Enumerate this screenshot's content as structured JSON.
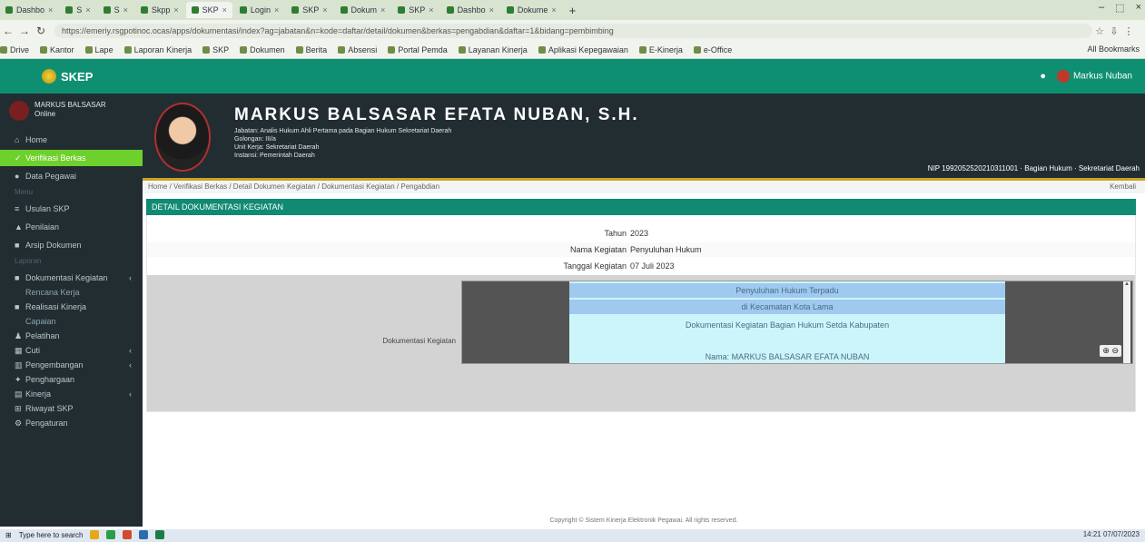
{
  "browser": {
    "tabs": [
      {
        "label": "Dashbo",
        "active": false
      },
      {
        "label": "S",
        "active": false
      },
      {
        "label": "S",
        "active": false
      },
      {
        "label": "Skpp",
        "active": false
      },
      {
        "label": "SKP",
        "active": true
      },
      {
        "label": "Login",
        "active": false
      },
      {
        "label": "SKP",
        "active": false
      },
      {
        "label": "Dokum",
        "active": false
      },
      {
        "label": "SKP",
        "active": false
      },
      {
        "label": "Dashbo",
        "active": false
      },
      {
        "label": "Dokume",
        "active": false
      }
    ],
    "new_tab": "+",
    "window_controls": [
      "–",
      "⬚",
      "×"
    ],
    "url": "https://emeriy.rsgpotinoc.ocas/apps/dokumentasi/index?ag=jabatan&n=kode=daftar/detail/dokumen&berkas=pengabdian&daftar=1&bidang=pembimbing",
    "bookmarks": [
      "Drive",
      "Kantor",
      "Lape",
      "Laporan Kinerja",
      "SKP",
      "Dokumen",
      "Berita",
      "Absensi",
      "Portal Pemda",
      "Layanan Kinerja",
      "Aplikasi Kepegawaian",
      "E-Kinerja",
      "e-Office"
    ],
    "all_bookmarks": "All Bookmarks"
  },
  "app": {
    "logo": "SKEP",
    "user_short": "Markus Nuban"
  },
  "sidebar": {
    "user_name": "MARKUS BALSASAR",
    "user_status": "Online",
    "items": [
      {
        "label": "Home",
        "icon": "home-icon",
        "glyph": "⌂",
        "active": false,
        "caret": false
      },
      {
        "label": "Verifikasi Berkas",
        "icon": "check-icon",
        "glyph": "✓",
        "active": true,
        "caret": false
      },
      {
        "label": "Data Pegawai",
        "icon": "user-icon",
        "glyph": "●",
        "active": false,
        "caret": false
      }
    ],
    "section_1": "Menu",
    "items_2": [
      {
        "label": "Usulan SKP",
        "icon": "list-icon",
        "glyph": "≡",
        "active": false,
        "caret": false
      },
      {
        "label": "Penilaian",
        "icon": "star-icon",
        "glyph": "▲",
        "active": false,
        "caret": false
      },
      {
        "label": "Arsip Dokumen",
        "icon": "folder-icon",
        "glyph": "■",
        "active": false,
        "caret": false
      }
    ],
    "section_2": "Laporan",
    "items_3": [
      {
        "label": "Dokumentasi Kegiatan",
        "icon": "doc-icon",
        "glyph": "■",
        "active": false,
        "caret": true,
        "sub": false
      },
      {
        "label": "Rencana Kerja",
        "icon": "",
        "glyph": "",
        "active": false,
        "caret": false,
        "sub": true
      },
      {
        "label": "Realisasi Kinerja",
        "icon": "file-icon",
        "glyph": "■",
        "active": false,
        "caret": false,
        "sub": false
      },
      {
        "label": "Capaian",
        "icon": "",
        "glyph": "",
        "active": false,
        "caret": false,
        "sub": true
      },
      {
        "label": "Pelatihan",
        "icon": "people-icon",
        "glyph": "♟",
        "active": false,
        "caret": false,
        "sub": false
      },
      {
        "label": "Cuti",
        "icon": "calendar-icon",
        "glyph": "▦",
        "active": false,
        "caret": true,
        "sub": false
      },
      {
        "label": "Pengembangan",
        "icon": "chart-icon",
        "glyph": "▥",
        "active": false,
        "caret": true,
        "sub": false
      },
      {
        "label": "Penghargaan",
        "icon": "award-icon",
        "glyph": "✦",
        "active": false,
        "caret": false,
        "sub": false
      },
      {
        "label": "Kinerja",
        "icon": "bar-icon",
        "glyph": "▤",
        "active": false,
        "caret": true,
        "sub": false
      },
      {
        "label": "Riwayat SKP",
        "icon": "history-icon",
        "glyph": "⊞",
        "active": false,
        "caret": false,
        "sub": false
      },
      {
        "label": "Pengaturan",
        "icon": "gear-icon",
        "glyph": "⚙",
        "active": false,
        "caret": false,
        "sub": false
      }
    ]
  },
  "profile": {
    "name": "MARKUS BALSASAR EFATA NUBAN, S.H.",
    "info_lines": [
      "Jabatan: Analis Hukum Ahli Pertama pada Bagian Hukum Sekretariat Daerah",
      "Golongan: III/a",
      "Unit Kerja: Sekretariat Daerah",
      "Instansi: Pemerintah Daerah"
    ],
    "nip_line": "NIP 1992052520210311001 · Bagian Hukum · Sekretariat Daerah"
  },
  "breadcrumb": {
    "path": "Home / Verifikasi Berkas / Detail Dokumen Kegiatan / Dokumentasi Kegiatan / Pengabdian",
    "right": "Kembali"
  },
  "box": {
    "title": "DETAIL DOKUMENTASI KEGIATAN",
    "rows": [
      {
        "label": "Tahun",
        "value": "2023"
      },
      {
        "label": "Nama Kegiatan",
        "value": "Penyuluhan Hukum"
      },
      {
        "label": "Tanggal Kegiatan",
        "value": "07 Juli 2023"
      }
    ],
    "doc_label": "Dokumentasi Kegiatan",
    "doc_lines": [
      "Penyuluhan Hukum Terpadu",
      "di Kecamatan Kota Lama",
      "Dokumentasi Kegiatan Bagian Hukum Setda Kabupaten",
      "Nama: MARKUS BALSASAR EFATA NUBAN"
    ],
    "zoom": "⊕ ⊖"
  },
  "footer": "Copyright © Sistem Kinerja Elektronik Pegawai. All rights reserved.",
  "taskbar": {
    "left": "Type here to search",
    "right": "14:21 07/07/2023"
  }
}
